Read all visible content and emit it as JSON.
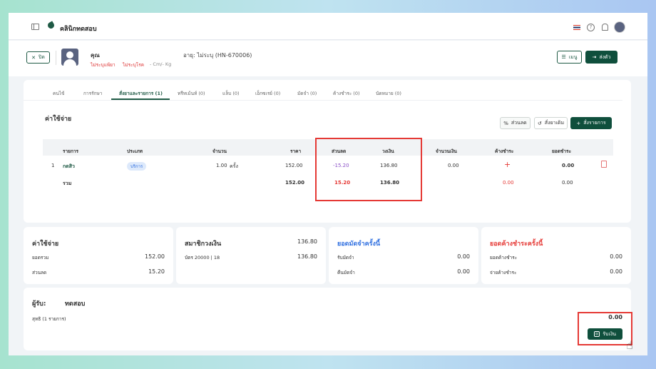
{
  "header": {
    "clinic_name": "คลินิกทดสอบ"
  },
  "patient": {
    "prefix": "คุณ",
    "age_label": "อายุ: ไม่ระบุ (HN-670006)",
    "allergy": "ไม่ระบุแพ้ยา",
    "disease": "ไม่ระบุโรค",
    "body": "- Cm/- Kg",
    "close_label": "ปิด",
    "menu_label": "เมนู",
    "refer_label": "ส่งตัว"
  },
  "tabs": [
    {
      "label": "คนไข้"
    },
    {
      "label": "การรักษา"
    },
    {
      "label": "สั่งยาและรายการ (1)"
    },
    {
      "label": "ทรีทเม้นท์ (0)"
    },
    {
      "label": "แล็บ (0)"
    },
    {
      "label": "เอ็กซเรย์ (0)"
    },
    {
      "label": "มัดจำ (0)"
    },
    {
      "label": "ค้างชำระ (0)"
    },
    {
      "label": "นัดหมาย (0)"
    }
  ],
  "section": {
    "title": "ค่าใช้จ่าย",
    "discount_btn": "ส่วนลด",
    "reorder_btn": "สั่งยาเดิม",
    "order_btn": "สั่งรายการ"
  },
  "table": {
    "headers": [
      "รายการ",
      "ประเภท",
      "จำนวน",
      "ราคา",
      "ส่วนลด",
      "วงเงิน",
      "จำนวนเงิน",
      "ค้างชำระ",
      "ยอดชำระ"
    ],
    "rows": [
      {
        "no": "1",
        "name": "กดสิว",
        "type": "บริการ",
        "qty": "1.00",
        "unit": "ครั้ง",
        "price": "152.00",
        "discount": "-15.20",
        "credit": "136.80",
        "amount": "0.00",
        "outstanding": "+",
        "paid": "0.00"
      }
    ],
    "total": {
      "label": "รวม",
      "price": "152.00",
      "discount": "15.20",
      "credit": "136.80",
      "outstanding": "0.00",
      "paid": "0.00"
    }
  },
  "summary": {
    "expense": {
      "title": "ค่าใช้จ่าย",
      "total_label": "ยอดรวม",
      "total": "152.00",
      "discount_label": "ส่วนลด",
      "discount": "15.20"
    },
    "member": {
      "title": "สมาชิกวงเงิน",
      "title_value": "136.80",
      "card_label": "บัตร 20000 | 18",
      "card_value": "136.80"
    },
    "deposit": {
      "title": "ยอดมัดจำครั้งนี้",
      "receive_label": "รับมัดจำ",
      "receive": "0.00",
      "return_label": "คืนมัดจำ",
      "return": "0.00"
    },
    "outstanding": {
      "title": "ยอดค้างชำระครั้งนี้",
      "out_label": "ยอดค้างชำระ",
      "out": "0.00",
      "pay_label": "จ่ายค้างชำระ",
      "pay": "0.00"
    }
  },
  "receiver": {
    "label": "ผู้รับ:",
    "name": "ทดสอบ",
    "net_label": "สุทธิ (1 รายการ)",
    "net": "0.00",
    "receive_btn": "รับเงิน"
  },
  "colors": {
    "primary": "#0f4f3c",
    "danger": "#e53935",
    "blue": "#2f6fe0"
  }
}
